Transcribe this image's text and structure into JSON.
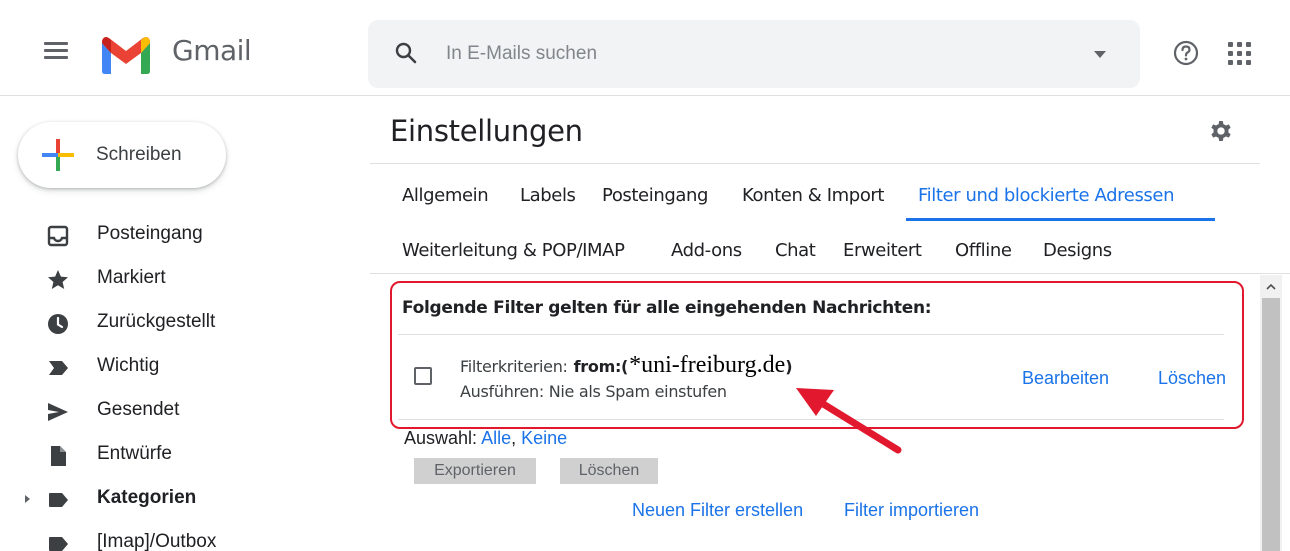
{
  "app": {
    "name": "Gmail",
    "brand_colors": {
      "red": "#ea4335",
      "blue": "#4285f4",
      "green": "#34a853",
      "yellow": "#fbbc04",
      "link": "#1a73e8"
    }
  },
  "header": {
    "search_placeholder": "In E-Mails suchen",
    "icons": [
      "menu-icon",
      "gmail-logo",
      "search-icon",
      "chevron-down-icon",
      "help-icon",
      "apps-icon"
    ]
  },
  "sidebar": {
    "compose_label": "Schreiben",
    "items": [
      {
        "label": "Posteingang",
        "icon": "inbox-icon"
      },
      {
        "label": "Markiert",
        "icon": "star-icon"
      },
      {
        "label": "Zurückgestellt",
        "icon": "clock-icon"
      },
      {
        "label": "Wichtig",
        "icon": "important-icon"
      },
      {
        "label": "Gesendet",
        "icon": "send-icon"
      },
      {
        "label": "Entwürfe",
        "icon": "draft-icon"
      },
      {
        "label": "Kategorien",
        "icon": "label-icon",
        "bold": true
      },
      {
        "label": "[Imap]/Outbox",
        "icon": "label-icon"
      }
    ]
  },
  "settings": {
    "title": "Einstellungen",
    "tabs_row1": [
      "Allgemein",
      "Labels",
      "Posteingang",
      "Konten & Import",
      "Filter und blockierte Adressen"
    ],
    "tabs_row2": [
      "Weiterleitung & POP/IMAP",
      "Add-ons",
      "Chat",
      "Erweitert",
      "Offline",
      "Designs"
    ],
    "active_tab": "Filter und blockierte Adressen"
  },
  "filters": {
    "heading": "Folgende Filter gelten für alle eingehenden Nachrichten:",
    "items": [
      {
        "criteria_label": "Filterkriterien:",
        "criteria_key": "from:(",
        "criteria_value": "*uni-freiburg.de",
        "criteria_close": ")",
        "action": "Ausführen: Nie als Spam einstufen",
        "edit_label": "Bearbeiten",
        "delete_label": "Löschen",
        "checked": false
      }
    ],
    "selection_prefix": "Auswahl:",
    "select_all": "Alle",
    "select_none": "Keine",
    "export_label": "Exportieren",
    "delete_selected_label": "Löschen",
    "new_filter_label": "Neuen Filter erstellen",
    "import_filter_label": "Filter importieren"
  },
  "annotations": {
    "highlight_color": "#e2192e"
  }
}
